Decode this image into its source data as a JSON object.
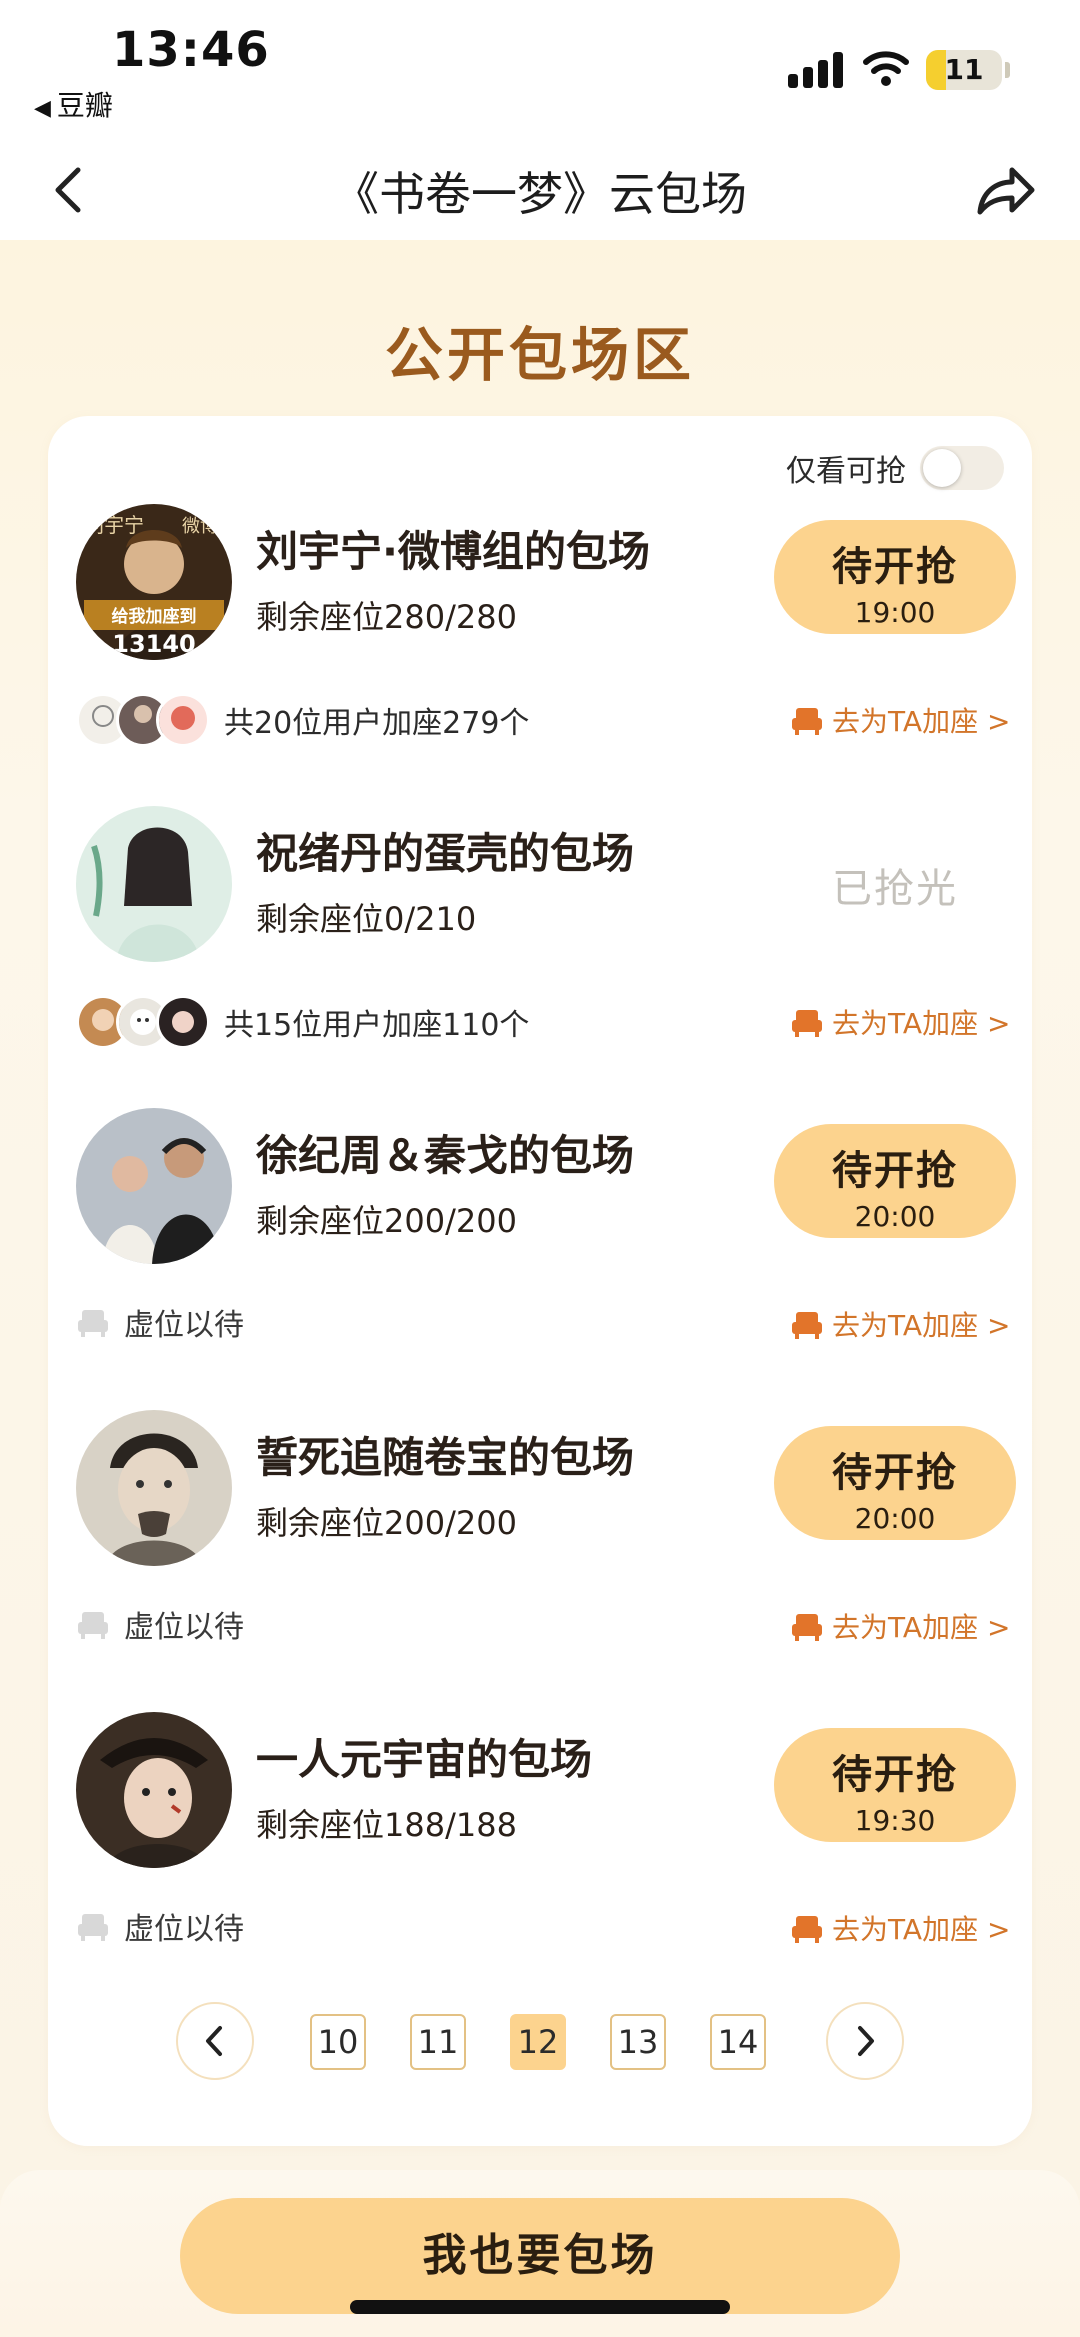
{
  "status_bar": {
    "time": "13:46",
    "back_app": "豆瓣",
    "battery": "11",
    "battery_level_percent": 11
  },
  "nav": {
    "title": "《书卷一梦》云包场"
  },
  "section_title": "公开包场区",
  "filter": {
    "label": "仅看可抢",
    "enabled": false
  },
  "rows": [
    {
      "title": "刘宇宁·微博组的包场",
      "seats": "剩余座位280/280",
      "status": "待开抢",
      "time": "19:00",
      "users_text": "共20位用户加座279个",
      "add_seat": "去为TA加座 >"
    },
    {
      "title": "祝绪丹的蛋壳的包场",
      "seats": "剩余座位0/210",
      "status": "已抢光",
      "users_text": "共15位用户加座110个",
      "add_seat": "去为TA加座 >"
    },
    {
      "title": "徐纪周＆秦戈的包场",
      "seats": "剩余座位200/200",
      "status": "待开抢",
      "time": "20:00",
      "vacant_text": "虚位以待",
      "add_seat": "去为TA加座 >"
    },
    {
      "title": "誓死追随卷宝的包场",
      "seats": "剩余座位200/200",
      "status": "待开抢",
      "time": "20:00",
      "vacant_text": "虚位以待",
      "add_seat": "去为TA加座 >"
    },
    {
      "title": "一人元宇宙的包场",
      "seats": "剩余座位188/188",
      "status": "待开抢",
      "time": "19:30",
      "vacant_text": "虚位以待",
      "add_seat": "去为TA加座 >"
    }
  ],
  "avatar_badge": {
    "top_left": "刘宇宁",
    "top_right": "微博组",
    "slogan": "给我加座到",
    "number": "13140"
  },
  "pager": {
    "pages": [
      "10",
      "11",
      "12",
      "13",
      "14"
    ],
    "current": "12"
  },
  "cta": "我也要包场",
  "colors": {
    "accent": "#fcd38e",
    "section_title": "#9a5a1e",
    "link": "#d2752a",
    "soldout": "#c4c1bb"
  }
}
